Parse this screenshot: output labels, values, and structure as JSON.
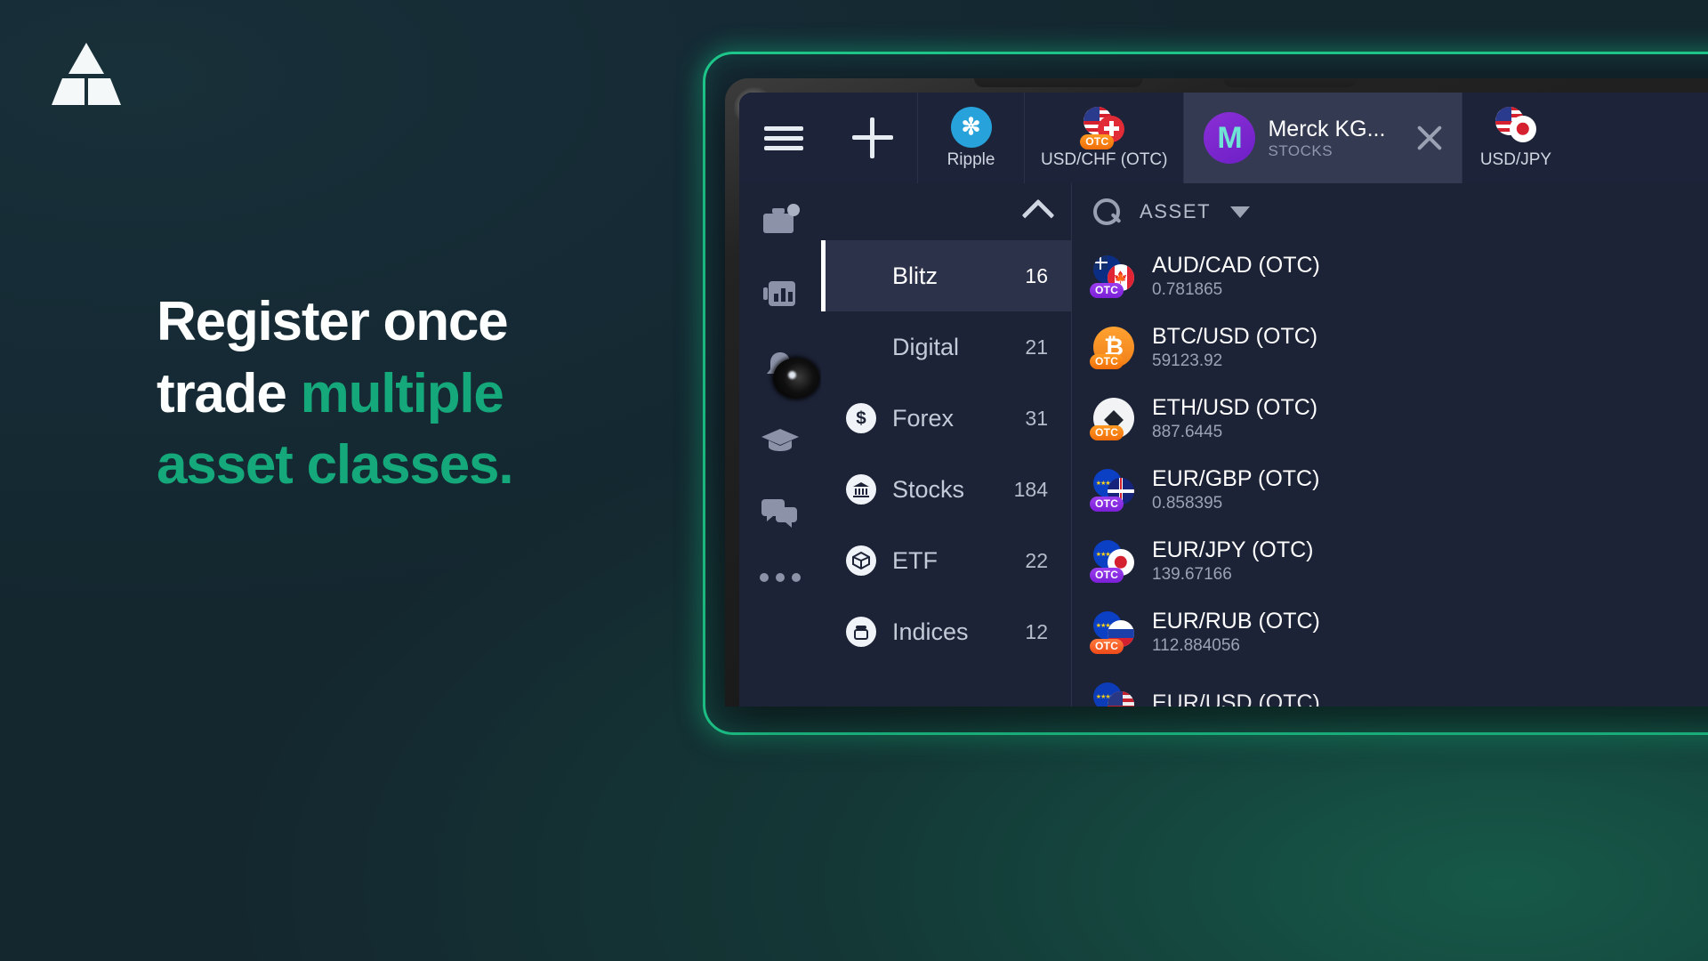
{
  "brand": {
    "logo_name": "triangle-logo",
    "accent_green": "#14a87b",
    "glow_green": "#1ec98c"
  },
  "hero": {
    "line1": "Register once",
    "line2_white": "trade ",
    "line2_green": "multiple",
    "line3_green": "asset classes",
    "line3_dot": "."
  },
  "app": {
    "toolbar": {
      "menu_label": "menu",
      "add_label": "add"
    },
    "tabs": [
      {
        "label": "Ripple",
        "icon": "ripple-coin-icon",
        "active": false
      },
      {
        "label": "USD/CHF (OTC)",
        "icon": "usd-chf-flag-icon",
        "active": false
      },
      {
        "label": "Merck KG...",
        "sublabel": "STOCKS",
        "icon": "merck-logo-icon",
        "active": true,
        "close": "×"
      },
      {
        "label": "USD/JPY",
        "icon": "usd-jpy-flag-icon",
        "active": false
      }
    ],
    "rail": [
      {
        "name": "portfolio-icon"
      },
      {
        "name": "chart-icon"
      },
      {
        "name": "bell-icon"
      },
      {
        "name": "education-icon"
      },
      {
        "name": "chat-icon"
      },
      {
        "name": "more-icon"
      }
    ],
    "categories": {
      "collapse_icon": "chevron-up-icon",
      "items": [
        {
          "label": "Blitz",
          "count": "16",
          "icon": null,
          "selected": true
        },
        {
          "label": "Digital",
          "count": "21",
          "icon": null,
          "selected": false
        },
        {
          "label": "Forex",
          "count": "31",
          "icon": "dollar-icon",
          "selected": false
        },
        {
          "label": "Stocks",
          "count": "184",
          "icon": "bank-icon",
          "selected": false
        },
        {
          "label": "ETF",
          "count": "22",
          "icon": "cube-icon",
          "selected": false
        },
        {
          "label": "Indices",
          "count": "12",
          "icon": "box-icon",
          "selected": false
        }
      ]
    },
    "search": {
      "icon": "search-icon",
      "label": "ASSET",
      "sort_icon": "triangle-down-icon"
    },
    "assets": [
      {
        "name": "AUD/CAD (OTC)",
        "price": "0.781865",
        "icon": "aud-cad-flag-icon"
      },
      {
        "name": "BTC/USD (OTC)",
        "price": "59123.92",
        "icon": "bitcoin-icon"
      },
      {
        "name": "ETH/USD (OTC)",
        "price": "887.6445",
        "icon": "ethereum-icon"
      },
      {
        "name": "EUR/GBP (OTC)",
        "price": "0.858395",
        "icon": "eur-gbp-flag-icon"
      },
      {
        "name": "EUR/JPY (OTC)",
        "price": "139.67166",
        "icon": "eur-jpy-flag-icon"
      },
      {
        "name": "EUR/RUB (OTC)",
        "price": "112.884056",
        "icon": "eur-rub-flag-icon"
      },
      {
        "name": "EUR/USD (OTC)",
        "price": "",
        "icon": "eur-usd-flag-icon"
      }
    ],
    "otc_badge": "OTC"
  }
}
